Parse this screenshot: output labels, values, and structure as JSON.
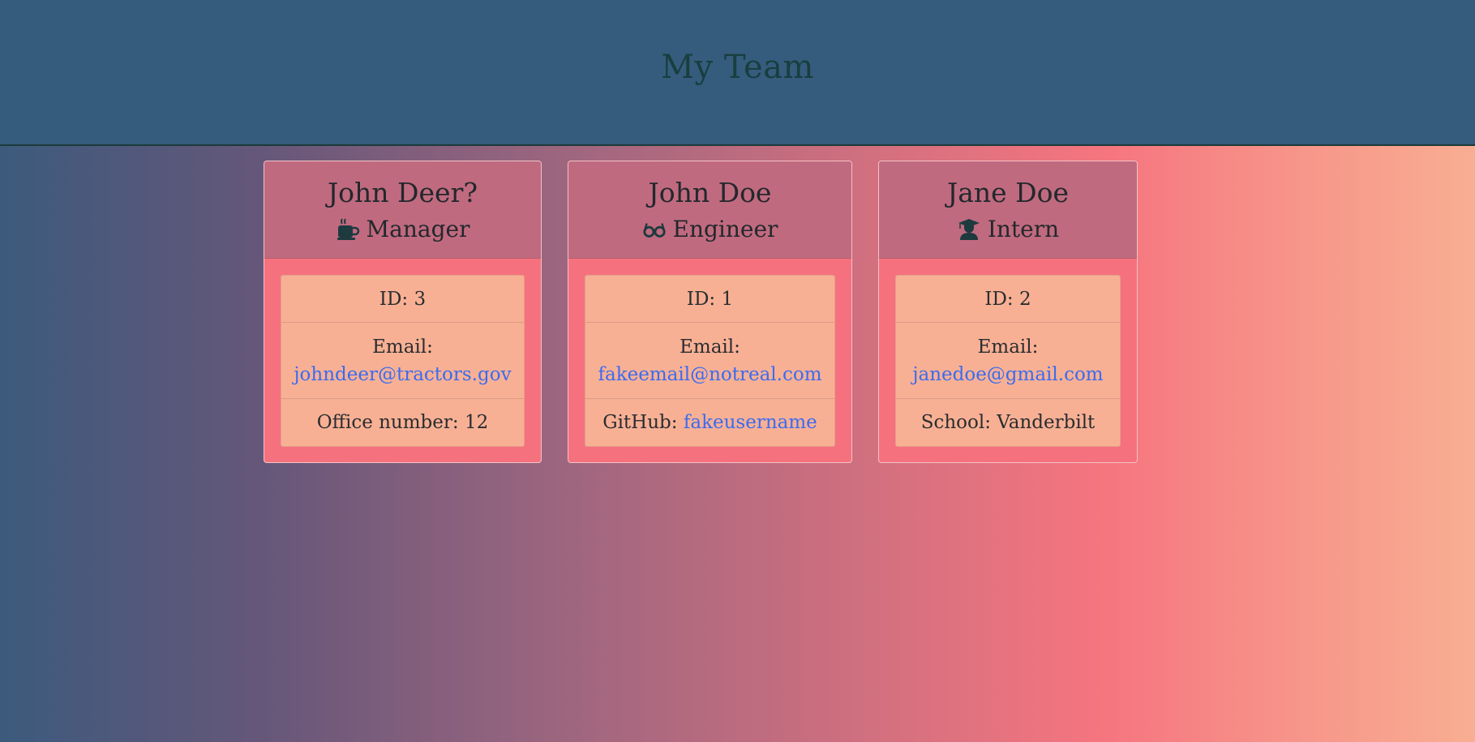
{
  "header": {
    "title": "My Team"
  },
  "cards": [
    {
      "name": "John Deer?",
      "role": "Manager",
      "role_icon": "coffee-mug-icon",
      "id_label": "ID: 3",
      "email_label": "Email:",
      "email": "johndeer@tractors.gov",
      "extra_label": "Office number: 12",
      "extra_link": ""
    },
    {
      "name": "John Doe",
      "role": "Engineer",
      "role_icon": "glasses-icon",
      "id_label": "ID: 1",
      "email_label": "Email:",
      "email": "fakeemail@notreal.com",
      "extra_label": "GitHub:",
      "extra_link": "fakeusername"
    },
    {
      "name": "Jane Doe",
      "role": "Intern",
      "role_icon": "graduate-icon",
      "id_label": "ID: 2",
      "email_label": "Email:",
      "email": "janedoe@gmail.com",
      "extra_label": "School: Vanderbilt",
      "extra_link": ""
    }
  ],
  "colors": {
    "header_bg": "#355c7d",
    "title_text": "#183e3f",
    "card_head_bg": "#c06a80",
    "card_body_bg": "#f6717e",
    "list_bg": "#f8b094",
    "link": "#3a6cf0"
  }
}
